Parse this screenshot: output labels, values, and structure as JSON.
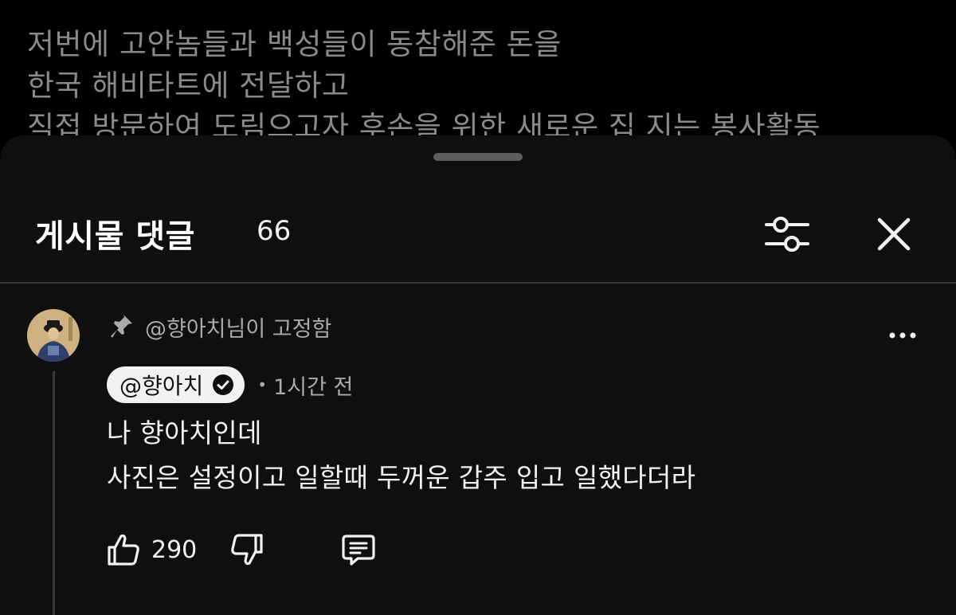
{
  "background_post": {
    "lines": [
      "저번에 고얀놈들과 백성들이 동참해준 돈을",
      "한국 해비타트에 전달하고",
      "직접 방문하여 도림으고자 후손을 위한 새로운 집 지는 봉사활동"
    ]
  },
  "sheet": {
    "title": "게시물 댓글",
    "count": "66"
  },
  "comment": {
    "pinned_text": "@향아치님이 고정함",
    "author": "@향아치",
    "separator": "•",
    "time": "1시간 전",
    "body_lines": [
      "나 향아치인데",
      "사진은 설정이고 일할때 두꺼운 갑주 입고 일했다더라"
    ],
    "likes": "290"
  },
  "colors": {
    "background": "#000000",
    "sheet": "#0f0f0f",
    "primary_text": "#f1f1f1",
    "secondary_text": "#aaaaaa",
    "divider": "#3a3a3a"
  },
  "icons": {
    "filter": "sliders-icon",
    "close": "close-icon",
    "pin": "pin-icon",
    "verified": "verified-check-icon",
    "like": "thumbs-up-icon",
    "dislike": "thumbs-down-icon",
    "reply": "reply-bubble-icon",
    "more": "more-horizontal-icon"
  }
}
